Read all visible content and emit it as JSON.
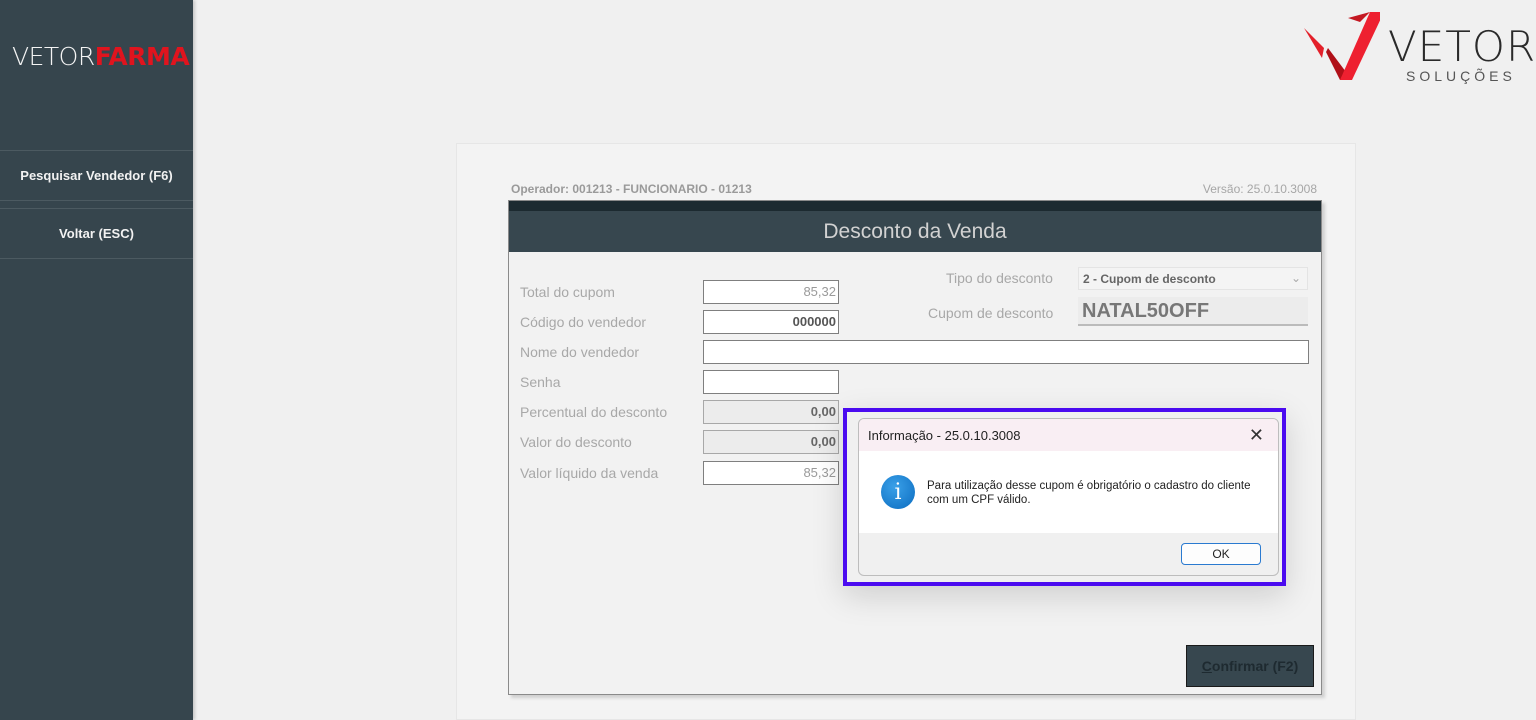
{
  "sidebar": {
    "brand_a": "VETOR",
    "brand_b": "FARMA",
    "items": [
      {
        "label": "Pesquisar Vendedor (F6)"
      },
      {
        "label": "Voltar (ESC)"
      }
    ]
  },
  "logo": {
    "name": "VETOR",
    "tagline": "SOLUÇÕES"
  },
  "header": {
    "operator": "Operador: 001213 - FUNCIONARIO - 01213",
    "version": "Versão: 25.0.10.3008"
  },
  "form": {
    "title": "Desconto da Venda",
    "fields": [
      {
        "label": "Total do cupom",
        "value": "85,32"
      },
      {
        "label": "Código do vendedor",
        "value": "000000"
      },
      {
        "label": "Nome do vendedor",
        "value": ""
      },
      {
        "label": "Senha",
        "value": ""
      },
      {
        "label": "Percentual do desconto",
        "value": "0,00"
      },
      {
        "label": "Valor do desconto",
        "value": "0,00"
      },
      {
        "label": "Valor líquido da venda",
        "value": "85,32"
      }
    ],
    "tipo_label": "Tipo do desconto",
    "tipo_value": "2 - Cupom de desconto",
    "cupom_label": "Cupom de desconto",
    "cupom_value": "NATAL50OFF",
    "confirm_u": "C",
    "confirm_rest": "onfirmar (F2)"
  },
  "dialog": {
    "title": "Informação - 25.0.10.3008",
    "message": "Para utilização desse cupom é obrigatório o cadastro do cliente com um CPF válido.",
    "ok": "OK",
    "close": "✕",
    "info_glyph": "i"
  },
  "colors": {
    "sidebar": "#36454d",
    "accent_red": "#e0141e",
    "highlight": "#4b0bf0"
  }
}
